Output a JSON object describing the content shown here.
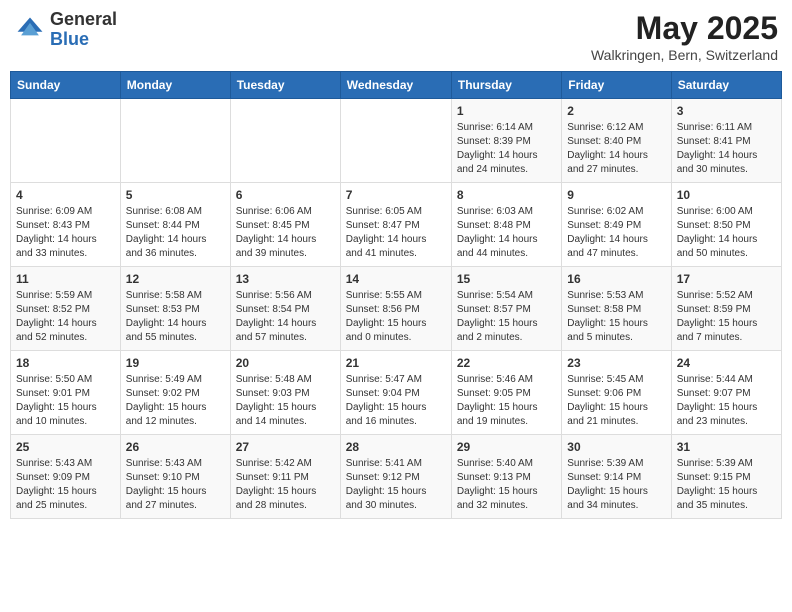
{
  "header": {
    "logo_general": "General",
    "logo_blue": "Blue",
    "month_title": "May 2025",
    "location": "Walkringen, Bern, Switzerland"
  },
  "days_of_week": [
    "Sunday",
    "Monday",
    "Tuesday",
    "Wednesday",
    "Thursday",
    "Friday",
    "Saturday"
  ],
  "weeks": [
    [
      {
        "num": "",
        "info": ""
      },
      {
        "num": "",
        "info": ""
      },
      {
        "num": "",
        "info": ""
      },
      {
        "num": "",
        "info": ""
      },
      {
        "num": "1",
        "info": "Sunrise: 6:14 AM\nSunset: 8:39 PM\nDaylight: 14 hours\nand 24 minutes."
      },
      {
        "num": "2",
        "info": "Sunrise: 6:12 AM\nSunset: 8:40 PM\nDaylight: 14 hours\nand 27 minutes."
      },
      {
        "num": "3",
        "info": "Sunrise: 6:11 AM\nSunset: 8:41 PM\nDaylight: 14 hours\nand 30 minutes."
      }
    ],
    [
      {
        "num": "4",
        "info": "Sunrise: 6:09 AM\nSunset: 8:43 PM\nDaylight: 14 hours\nand 33 minutes."
      },
      {
        "num": "5",
        "info": "Sunrise: 6:08 AM\nSunset: 8:44 PM\nDaylight: 14 hours\nand 36 minutes."
      },
      {
        "num": "6",
        "info": "Sunrise: 6:06 AM\nSunset: 8:45 PM\nDaylight: 14 hours\nand 39 minutes."
      },
      {
        "num": "7",
        "info": "Sunrise: 6:05 AM\nSunset: 8:47 PM\nDaylight: 14 hours\nand 41 minutes."
      },
      {
        "num": "8",
        "info": "Sunrise: 6:03 AM\nSunset: 8:48 PM\nDaylight: 14 hours\nand 44 minutes."
      },
      {
        "num": "9",
        "info": "Sunrise: 6:02 AM\nSunset: 8:49 PM\nDaylight: 14 hours\nand 47 minutes."
      },
      {
        "num": "10",
        "info": "Sunrise: 6:00 AM\nSunset: 8:50 PM\nDaylight: 14 hours\nand 50 minutes."
      }
    ],
    [
      {
        "num": "11",
        "info": "Sunrise: 5:59 AM\nSunset: 8:52 PM\nDaylight: 14 hours\nand 52 minutes."
      },
      {
        "num": "12",
        "info": "Sunrise: 5:58 AM\nSunset: 8:53 PM\nDaylight: 14 hours\nand 55 minutes."
      },
      {
        "num": "13",
        "info": "Sunrise: 5:56 AM\nSunset: 8:54 PM\nDaylight: 14 hours\nand 57 minutes."
      },
      {
        "num": "14",
        "info": "Sunrise: 5:55 AM\nSunset: 8:56 PM\nDaylight: 15 hours\nand 0 minutes."
      },
      {
        "num": "15",
        "info": "Sunrise: 5:54 AM\nSunset: 8:57 PM\nDaylight: 15 hours\nand 2 minutes."
      },
      {
        "num": "16",
        "info": "Sunrise: 5:53 AM\nSunset: 8:58 PM\nDaylight: 15 hours\nand 5 minutes."
      },
      {
        "num": "17",
        "info": "Sunrise: 5:52 AM\nSunset: 8:59 PM\nDaylight: 15 hours\nand 7 minutes."
      }
    ],
    [
      {
        "num": "18",
        "info": "Sunrise: 5:50 AM\nSunset: 9:01 PM\nDaylight: 15 hours\nand 10 minutes."
      },
      {
        "num": "19",
        "info": "Sunrise: 5:49 AM\nSunset: 9:02 PM\nDaylight: 15 hours\nand 12 minutes."
      },
      {
        "num": "20",
        "info": "Sunrise: 5:48 AM\nSunset: 9:03 PM\nDaylight: 15 hours\nand 14 minutes."
      },
      {
        "num": "21",
        "info": "Sunrise: 5:47 AM\nSunset: 9:04 PM\nDaylight: 15 hours\nand 16 minutes."
      },
      {
        "num": "22",
        "info": "Sunrise: 5:46 AM\nSunset: 9:05 PM\nDaylight: 15 hours\nand 19 minutes."
      },
      {
        "num": "23",
        "info": "Sunrise: 5:45 AM\nSunset: 9:06 PM\nDaylight: 15 hours\nand 21 minutes."
      },
      {
        "num": "24",
        "info": "Sunrise: 5:44 AM\nSunset: 9:07 PM\nDaylight: 15 hours\nand 23 minutes."
      }
    ],
    [
      {
        "num": "25",
        "info": "Sunrise: 5:43 AM\nSunset: 9:09 PM\nDaylight: 15 hours\nand 25 minutes."
      },
      {
        "num": "26",
        "info": "Sunrise: 5:43 AM\nSunset: 9:10 PM\nDaylight: 15 hours\nand 27 minutes."
      },
      {
        "num": "27",
        "info": "Sunrise: 5:42 AM\nSunset: 9:11 PM\nDaylight: 15 hours\nand 28 minutes."
      },
      {
        "num": "28",
        "info": "Sunrise: 5:41 AM\nSunset: 9:12 PM\nDaylight: 15 hours\nand 30 minutes."
      },
      {
        "num": "29",
        "info": "Sunrise: 5:40 AM\nSunset: 9:13 PM\nDaylight: 15 hours\nand 32 minutes."
      },
      {
        "num": "30",
        "info": "Sunrise: 5:39 AM\nSunset: 9:14 PM\nDaylight: 15 hours\nand 34 minutes."
      },
      {
        "num": "31",
        "info": "Sunrise: 5:39 AM\nSunset: 9:15 PM\nDaylight: 15 hours\nand 35 minutes."
      }
    ]
  ]
}
